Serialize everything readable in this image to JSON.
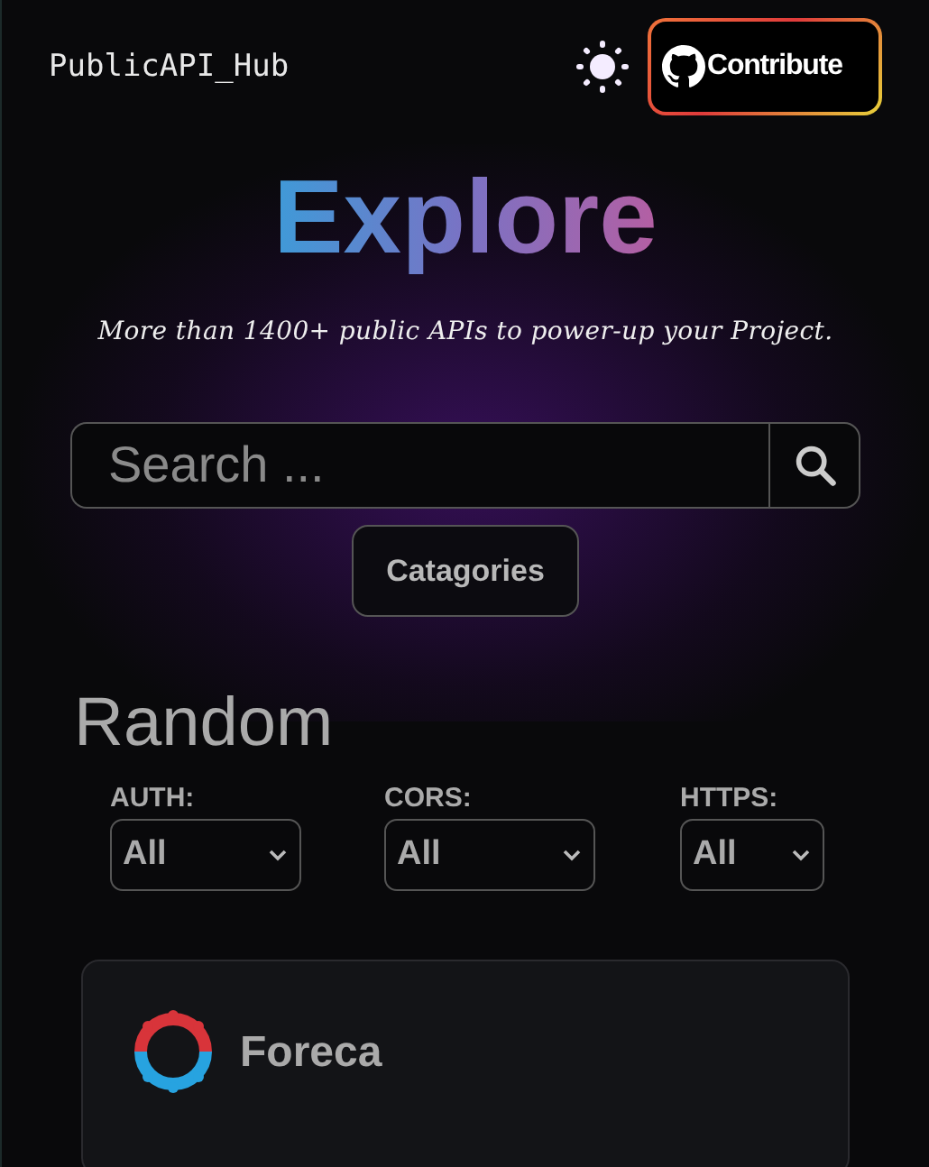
{
  "header": {
    "brand": "PublicAPI_Hub",
    "contribute_button": "Contribute"
  },
  "hero": {
    "title": "Explore",
    "subtitle": "More than 1400+ public APIs to power-up your Project."
  },
  "search": {
    "placeholder": "Search ..."
  },
  "categories_button": "Catagories",
  "random": {
    "heading": "Random",
    "filters": [
      {
        "label": "AUTH:",
        "value": "All"
      },
      {
        "label": "CORS:",
        "value": "All"
      },
      {
        "label": "HTTPS:",
        "value": "All"
      }
    ],
    "cards": [
      {
        "name": "Foreca"
      }
    ]
  }
}
